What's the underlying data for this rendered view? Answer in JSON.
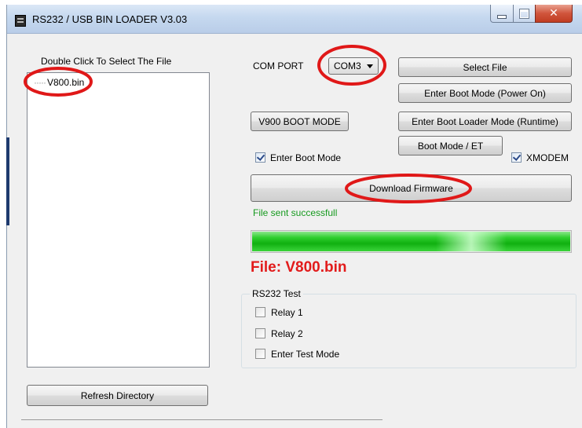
{
  "window": {
    "title": "RS232 / USB BIN LOADER V3.03"
  },
  "file_list": {
    "heading": "Double Click To Select The File",
    "items": [
      "V800.bin"
    ]
  },
  "buttons": {
    "refresh": "Refresh Directory",
    "select_file": "Select File",
    "boot_power_on": "Enter Boot Mode (Power On)",
    "v900_boot": "V900 BOOT MODE",
    "boot_loader_runtime": "Enter Boot Loader Mode (Runtime)",
    "boot_et": "Boot Mode / ET",
    "download": "Download Firmware"
  },
  "com_port": {
    "label": "COM PORT",
    "selected": "COM3"
  },
  "checkboxes": {
    "enter_boot_mode": {
      "label": "Enter Boot Mode",
      "checked": true
    },
    "xmodem": {
      "label": "XMODEM",
      "checked": true
    }
  },
  "status": {
    "text": "File sent successfull",
    "color": "#169a1e"
  },
  "progress": {
    "percent": 100
  },
  "file_info": {
    "text": "File: V800.bin",
    "color": "#e21b1b"
  },
  "rs232_test": {
    "title": "RS232 Test",
    "options": [
      {
        "label": "Relay 1",
        "checked": false
      },
      {
        "label": "Relay 2",
        "checked": false
      },
      {
        "label": "Enter Test Mode",
        "checked": false
      }
    ]
  },
  "annotation_color": "#e01818"
}
